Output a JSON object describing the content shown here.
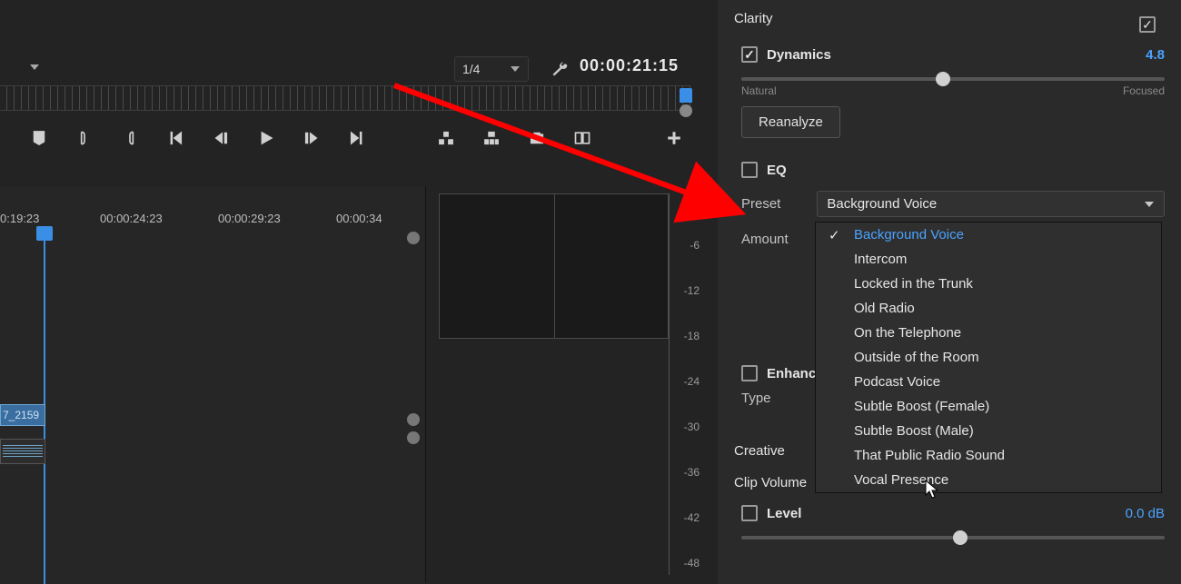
{
  "editor": {
    "zoom_value": "1/4",
    "timecode": "00:00:21:15",
    "timeline_labels": [
      "0:19:23",
      "00:00:24:23",
      "00:00:29:23",
      "00:00:34"
    ],
    "clip_label": "7_2159"
  },
  "meter_ticks": [
    "-6",
    "-12",
    "-18",
    "-24",
    "-30",
    "-36",
    "-42",
    "-48"
  ],
  "panel": {
    "clarity_title": "Clarity",
    "dynamics_label": "Dynamics",
    "dynamics_value": "4.8",
    "slider_min_label": "Natural",
    "slider_max_label": "Focused",
    "reanalyze_label": "Reanalyze",
    "eq_label": "EQ",
    "preset_label": "Preset",
    "preset_selected": "Background Voice",
    "amount_label": "Amount",
    "enhance_label": "Enhance",
    "type_label": "Type",
    "creative_label": "Creative",
    "clipvolume_label": "Clip Volume",
    "level_label": "Level",
    "level_value": "0.0 dB"
  },
  "preset_options": [
    "Background Voice",
    "Intercom",
    "Locked in the Trunk",
    "Old Radio",
    "On the Telephone",
    "Outside of the Room",
    "Podcast Voice",
    "Subtle Boost (Female)",
    "Subtle Boost (Male)",
    "That Public Radio Sound",
    "Vocal Presence"
  ]
}
